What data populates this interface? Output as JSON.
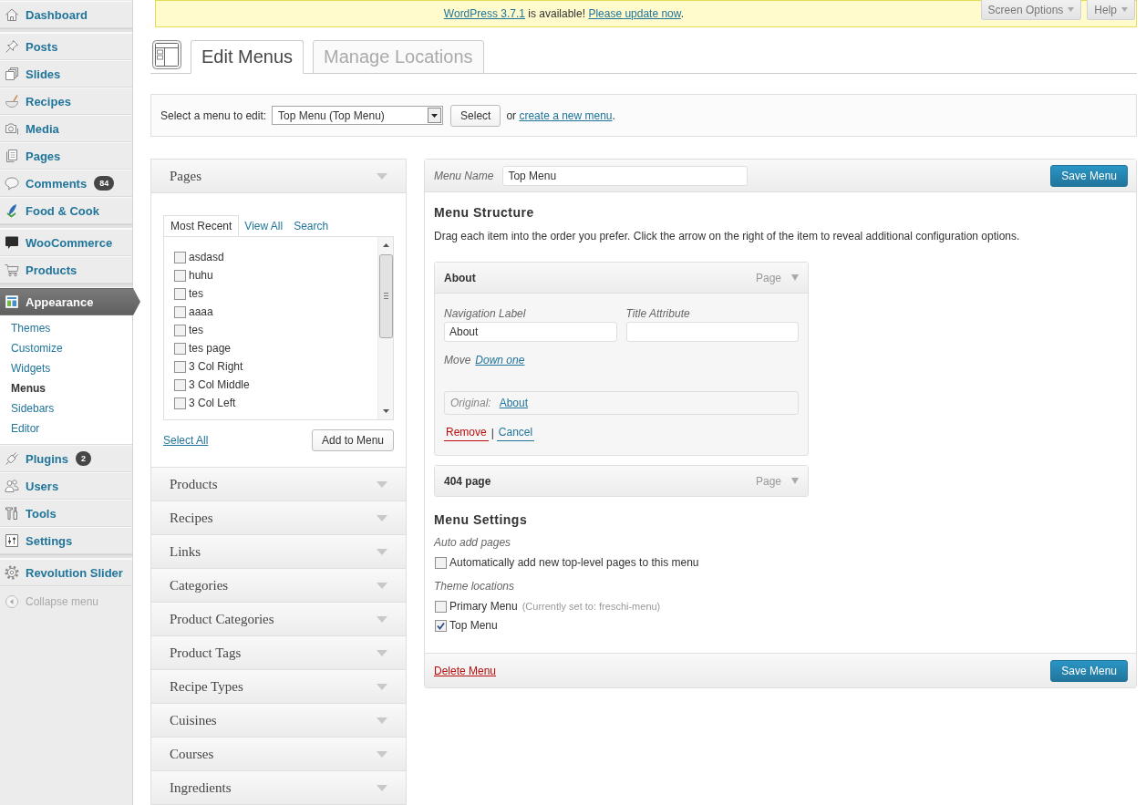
{
  "update_notice": {
    "parts": [
      {
        "kind": "link",
        "text": "WordPress 3.7.1"
      },
      {
        "kind": "text",
        "text": " is available! "
      },
      {
        "kind": "link",
        "text": "Please update now"
      },
      {
        "kind": "text",
        "text": "."
      }
    ]
  },
  "screen_meta": [
    {
      "label": "Screen Options"
    },
    {
      "label": "Help"
    }
  ],
  "sidebar": {
    "groups": [
      [
        {
          "label": "Dashboard",
          "selected": false
        }
      ],
      [
        {
          "label": "Posts",
          "selected": false
        },
        {
          "label": "Slides",
          "selected": false
        },
        {
          "label": "Recipes",
          "selected": false
        },
        {
          "label": "Media",
          "selected": false
        },
        {
          "label": "Pages",
          "selected": false
        },
        {
          "label": "Comments",
          "selected": false,
          "badge": "84"
        },
        {
          "label": "Food & Cook",
          "selected": false
        }
      ],
      [
        {
          "label": "WooCommerce",
          "selected": false
        },
        {
          "label": "Products",
          "selected": false
        }
      ],
      [
        {
          "label": "Appearance",
          "selected": true,
          "children": [
            {
              "label": "Themes",
              "selected": false
            },
            {
              "label": "Customize",
              "selected": false
            },
            {
              "label": "Widgets",
              "selected": false
            },
            {
              "label": "Menus",
              "selected": true
            },
            {
              "label": "Sidebars",
              "selected": false
            },
            {
              "label": "Editor",
              "selected": false
            }
          ]
        },
        {
          "label": "Plugins",
          "selected": false,
          "badge": "2"
        },
        {
          "label": "Users",
          "selected": false
        },
        {
          "label": "Tools",
          "selected": false
        },
        {
          "label": "Settings",
          "selected": false
        }
      ],
      [
        {
          "label": "Revolution Slider",
          "selected": false
        }
      ]
    ],
    "collapse": {
      "label": "Collapse menu"
    }
  },
  "tabs": [
    {
      "label": "Edit Menus",
      "selected": true
    },
    {
      "label": "Manage Locations",
      "selected": false
    }
  ],
  "menu_select": {
    "label": "Select a menu to edit:",
    "value": "Top Menu (Top Menu)",
    "button": "Select",
    "or_text": "or",
    "create_link": "create a new menu",
    "end_text": "."
  },
  "left_panel": {
    "sections": [
      {
        "title": "Pages",
        "expanded": true,
        "tabs": [
          {
            "label": "Most Recent",
            "selected": true
          },
          {
            "label": "View All",
            "selected": false
          },
          {
            "label": "Search",
            "selected": false
          }
        ],
        "items": [
          {
            "label": "asdasd",
            "checked": false
          },
          {
            "label": "huhu",
            "checked": false
          },
          {
            "label": "tes",
            "checked": false
          },
          {
            "label": "aaaa",
            "checked": false
          },
          {
            "label": "tes",
            "checked": false
          },
          {
            "label": "tes page",
            "checked": false
          },
          {
            "label": "3 Col Right",
            "checked": false
          },
          {
            "label": "3 Col Middle",
            "checked": false
          },
          {
            "label": "3 Col Left",
            "checked": false
          }
        ],
        "select_all": "Select All",
        "add_button": "Add to Menu"
      },
      {
        "title": "Products",
        "expanded": false
      },
      {
        "title": "Recipes",
        "expanded": false
      },
      {
        "title": "Links",
        "expanded": false
      },
      {
        "title": "Categories",
        "expanded": false
      },
      {
        "title": "Product Categories",
        "expanded": false
      },
      {
        "title": "Product Tags",
        "expanded": false
      },
      {
        "title": "Recipe Types",
        "expanded": false
      },
      {
        "title": "Cuisines",
        "expanded": false
      },
      {
        "title": "Courses",
        "expanded": false
      },
      {
        "title": "Ingredients",
        "expanded": false
      }
    ]
  },
  "menu_editor": {
    "name_label": "Menu Name",
    "name_value": "Top Menu",
    "save_button": "Save Menu",
    "structure_title": "Menu Structure",
    "structure_help": "Drag each item into the order you prefer. Click the arrow on the right of the item to reveal additional configuration options.",
    "items": [
      {
        "title": "About",
        "type": "Page",
        "expanded": true,
        "fields": [
          {
            "label": "Navigation Label",
            "value": "About"
          },
          {
            "label": "Title Attribute"
          }
        ],
        "move": {
          "label": "Move",
          "links": [
            "Down one"
          ]
        },
        "original": {
          "label": "Original:",
          "link": "About"
        },
        "actions": {
          "remove": "Remove",
          "separator": "|",
          "cancel": "Cancel"
        }
      },
      {
        "title": "404 page",
        "type": "Page",
        "expanded": false
      }
    ],
    "settings": {
      "title": "Menu Settings",
      "groups": [
        {
          "label": "Auto add pages",
          "options": [
            {
              "label": "Automatically add new top-level pages to this menu",
              "checked": false
            }
          ]
        },
        {
          "label": "Theme locations",
          "options": [
            {
              "label": "Primary Menu",
              "note": "(Currently set to: freschi-menu)",
              "checked": false
            },
            {
              "label": "Top Menu",
              "checked": true
            }
          ]
        }
      ]
    },
    "footer": {
      "delete_link": "Delete Menu",
      "save_button": "Save Menu"
    }
  }
}
